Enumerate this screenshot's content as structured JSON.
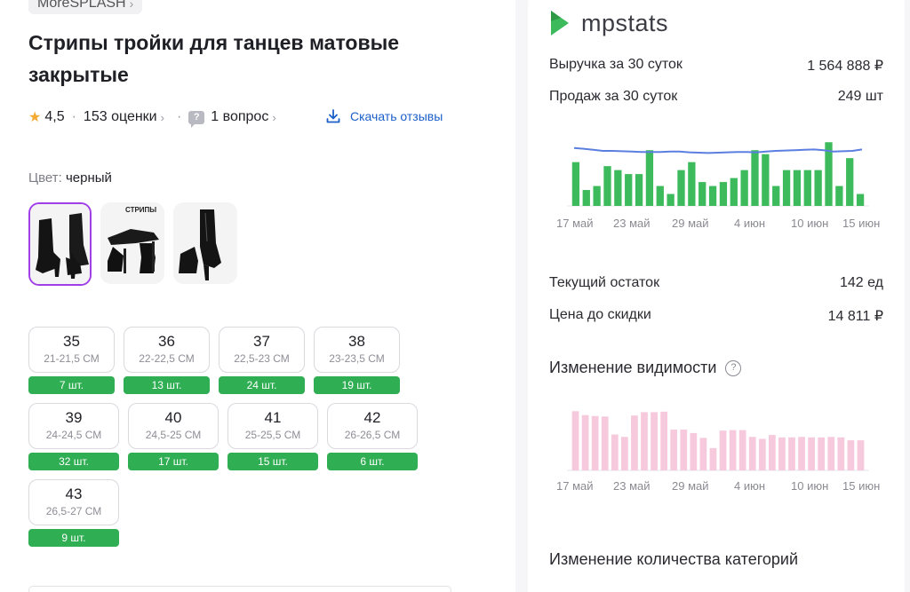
{
  "product": {
    "brand": "MoreSPLASH",
    "title": "Стрипы тройки для танцев матовые закрытые",
    "rating": "4,5",
    "reviews": "153 оценки",
    "questions": "1 вопрос",
    "download_reviews": "Скачать отзывы",
    "color_label": "Цвет:",
    "color_value": "черный",
    "thumb_label": "СТРИПЫ",
    "sizes": [
      {
        "size": "35",
        "cm": "21-21,5 СМ",
        "stock": "7 шт."
      },
      {
        "size": "36",
        "cm": "22-22,5 СМ",
        "stock": "13 шт."
      },
      {
        "size": "37",
        "cm": "22,5-23 СМ",
        "stock": "24 шт."
      },
      {
        "size": "38",
        "cm": "23-23,5 СМ",
        "stock": "19 шт."
      },
      {
        "size": "39",
        "cm": "24-24,5 СМ",
        "stock": "32 шт."
      },
      {
        "size": "40",
        "cm": "24,5-25 СМ",
        "stock": "17 шт."
      },
      {
        "size": "41",
        "cm": "25-25,5 СМ",
        "stock": "15 шт."
      },
      {
        "size": "42",
        "cm": "26-26,5 СМ",
        "stock": "6 шт."
      },
      {
        "size": "43",
        "cm": "26,5-27 СМ",
        "stock": "9 шт."
      }
    ]
  },
  "stats": {
    "logo": "mpstats",
    "revenue_label": "Выручка за 30 суток",
    "revenue_value": "1 564 888 ₽",
    "sales_label": "Продаж за 30 суток",
    "sales_value": "249 шт",
    "stock_label": "Текущий остаток",
    "stock_value": "142 ед",
    "price_label": "Цена до скидки",
    "price_value": "14 811 ₽",
    "visibility_title": "Изменение видимости",
    "categories_title": "Изменение количества категорий",
    "colors": {
      "sales_bar": "#3dbb5c",
      "price_line": "#5b7fe0",
      "visibility_bar": "#f7c9dc"
    }
  },
  "chart_data": [
    {
      "type": "bar",
      "name": "sales",
      "x_ticks": [
        "17 май",
        "23 май",
        "29 май",
        "4 июн",
        "10 июн",
        "15 июн"
      ],
      "values": [
        11,
        4,
        5,
        10,
        9,
        8,
        8,
        14,
        5,
        3,
        9,
        11,
        6,
        5,
        6,
        7,
        9,
        14,
        13,
        5,
        9,
        9,
        9,
        9,
        16,
        5,
        12,
        3
      ],
      "line_values": [
        0.78,
        0.76,
        0.73,
        0.7,
        0.7,
        0.69,
        0.68,
        0.67,
        0.67,
        0.67,
        0.68,
        0.68,
        0.66,
        0.65,
        0.64,
        0.65,
        0.66,
        0.67,
        0.67,
        0.66,
        0.68,
        0.7,
        0.71,
        0.72,
        0.73,
        0.74,
        0.72,
        0.68,
        0.69,
        0.7,
        0.74
      ]
    },
    {
      "type": "bar",
      "name": "visibility",
      "x_ticks": [
        "17 май",
        "23 май",
        "29 май",
        "4 июн",
        "10 июн",
        "15 июн"
      ],
      "values": [
        12.2,
        11.4,
        11.2,
        11.1,
        7.4,
        6.9,
        11.3,
        12.0,
        12.0,
        12.1,
        8.4,
        8.4,
        7.7,
        6.7,
        4.6,
        8.2,
        8.3,
        8.3,
        6.9,
        6.5,
        7.3,
        6.8,
        6.8,
        6.9,
        6.8,
        6.8,
        6.9,
        6.8,
        6.2,
        6.2
      ]
    }
  ]
}
